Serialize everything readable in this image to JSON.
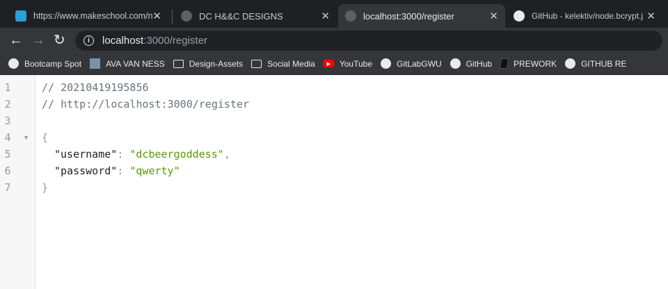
{
  "tabs": [
    {
      "label": "https://www.makeschool.com/n",
      "icon": "makeschool-icon",
      "active": false
    },
    {
      "label": "DC H&&C DESIGNS",
      "icon": "globe-icon",
      "active": false
    },
    {
      "label": "localhost:3000/register",
      "icon": "globe-icon",
      "active": true
    },
    {
      "label": "GitHub - kelektiv/node.bcrypt.j",
      "icon": "github-icon",
      "active": false
    }
  ],
  "toolbar": {
    "url_host": "localhost",
    "url_rest": ":3000/register"
  },
  "bookmarks": [
    {
      "label": "Bootcamp Spot",
      "icon": "globe-icon"
    },
    {
      "label": "AVA VAN NESS",
      "icon": "image-icon"
    },
    {
      "label": "Design-Assets",
      "icon": "folder-icon"
    },
    {
      "label": "Social Media",
      "icon": "folder-icon"
    },
    {
      "label": "YouTube",
      "icon": "youtube-icon"
    },
    {
      "label": "GitLabGWU",
      "icon": "globe-icon"
    },
    {
      "label": "GitHub",
      "icon": "github-icon"
    },
    {
      "label": "PREWORK",
      "icon": "book-icon"
    },
    {
      "label": "GITHUB RE",
      "icon": "github-icon"
    }
  ],
  "code": {
    "line_numbers": [
      "1",
      "2",
      "3",
      "4",
      "5",
      "6",
      "7"
    ],
    "comment1": "// 20210419195856",
    "comment2": "// http://localhost:3000/register",
    "open_brace": "{",
    "close_brace": "}",
    "username_key": "\"username\"",
    "username_value": "\"dcbeergoddess\"",
    "password_key": "\"password\"",
    "password_value": "\"qwerty\"",
    "colon": ": ",
    "comma": ","
  }
}
